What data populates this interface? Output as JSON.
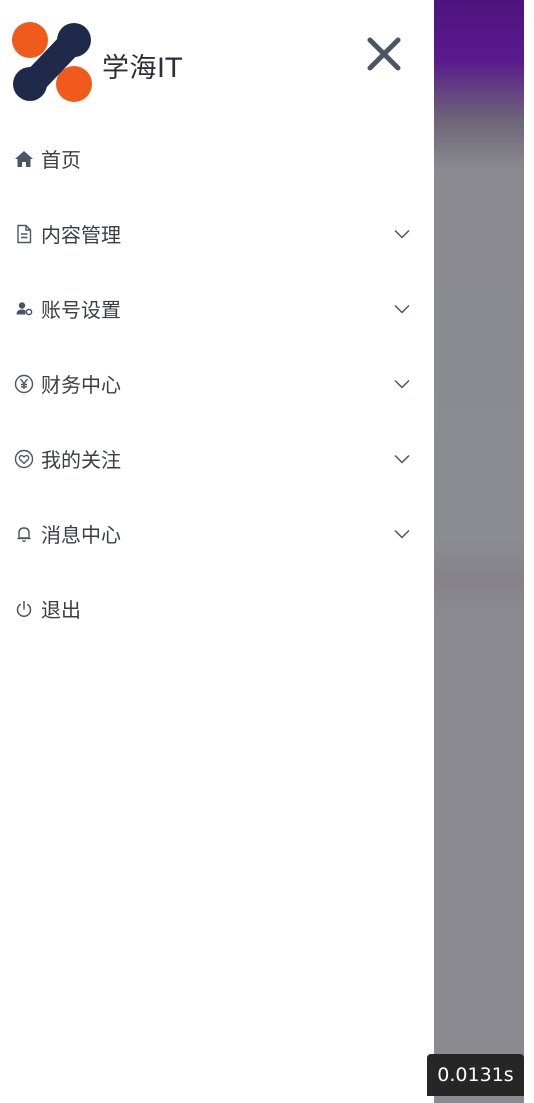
{
  "brand": {
    "name": "学海IT",
    "logo_icon": "brand-logo-icon",
    "colors": {
      "orange": "#f05a1a",
      "navy": "#1f2a4a"
    }
  },
  "close_icon": "close-icon",
  "menu": [
    {
      "label": "首页",
      "icon": "home-icon",
      "expandable": false
    },
    {
      "label": "内容管理",
      "icon": "document-icon",
      "expandable": true
    },
    {
      "label": "账号设置",
      "icon": "user-settings-icon",
      "expandable": true
    },
    {
      "label": "财务中心",
      "icon": "yen-icon",
      "expandable": true
    },
    {
      "label": "我的关注",
      "icon": "heart-icon",
      "expandable": true
    },
    {
      "label": "消息中心",
      "icon": "bell-icon",
      "expandable": true
    },
    {
      "label": "退出",
      "icon": "power-icon",
      "expandable": false
    }
  ],
  "timer": "0.0131s",
  "colors": {
    "icon": "#4b5563",
    "text": "#3a3f47",
    "backdrop_top": "#4e137f",
    "backdrop": "#8a8a90"
  }
}
